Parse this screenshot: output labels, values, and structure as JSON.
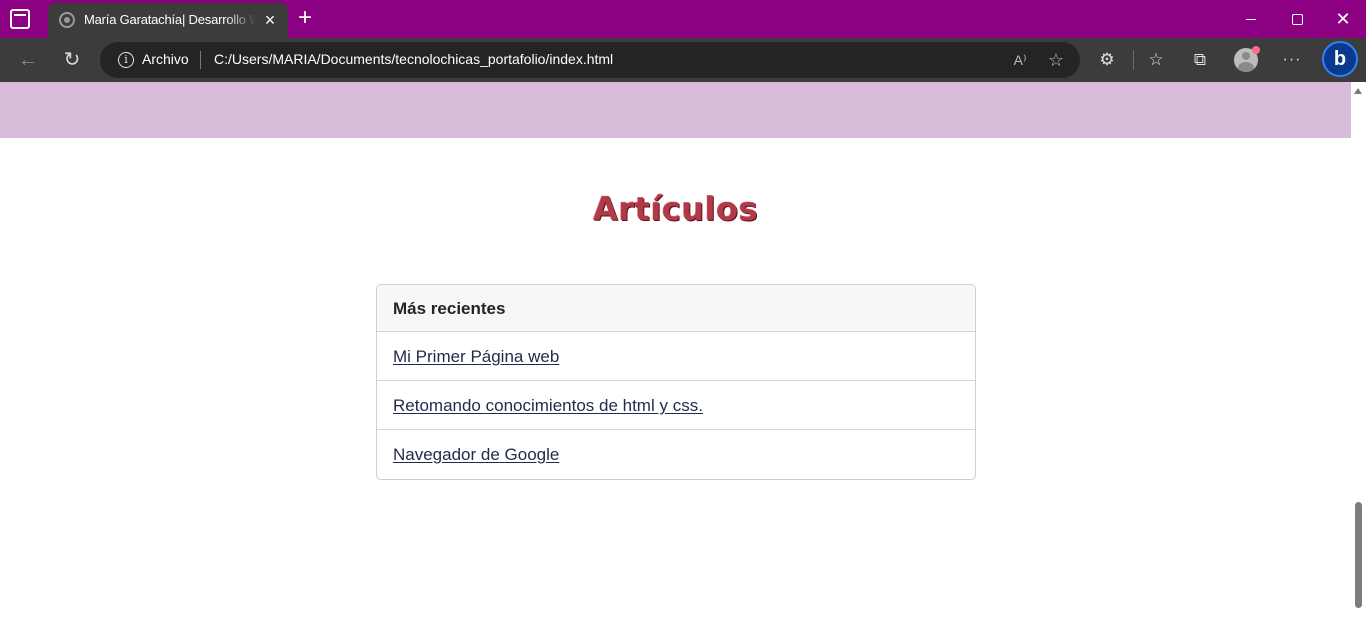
{
  "browser": {
    "tab": {
      "title": "María Garatachía| Desarrollo Web"
    },
    "new_tab_icon": "plus-icon",
    "address": {
      "site_info": "Archivo",
      "url": "C:/Users/MARIA/Documents/tecnolochicas_portafolio/index.html"
    }
  },
  "page": {
    "heading": "Artículos",
    "card": {
      "header": "Más recientes",
      "items": [
        "Mi Primer Página web",
        "Retomando conocimientos de html y css.",
        "Navegador de Google"
      ]
    }
  },
  "colors": {
    "tab_bar": "#8c0082",
    "header_band": "#d8bcd9",
    "heading": "#b23a48",
    "link": "#1f2b4a"
  }
}
